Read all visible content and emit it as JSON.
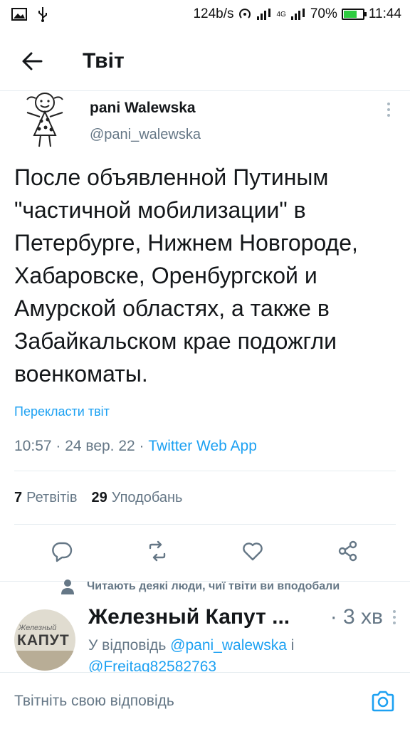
{
  "status": {
    "speed": "124b/s",
    "network": "4G",
    "battery": "70%",
    "battery_level": 0.7,
    "time": "11:44"
  },
  "header": {
    "title": "Твіт"
  },
  "tweet": {
    "author_name": "pani Walewska",
    "author_handle": "@pani_walewska",
    "text": "После объявленной Путиным \"частичной мобилизации\" в Петербурге, Нижнем Новгороде, Хабаровске, Оренбургской и Амурской областях, а также в Забайкальском крае подожгли военкоматы.",
    "translate_label": "Перекласти твіт",
    "timestamp": "10:57 · 24 вер. 22 · ",
    "source": "Twitter Web App",
    "retweets_count": "7",
    "retweets_label": "Ретвітів",
    "likes_count": "29",
    "likes_label": "Уподобань"
  },
  "suggestion": {
    "text": "Читають деякі люди, чиї твіти ви вподобали"
  },
  "reply": {
    "avatar_top": "Железный",
    "avatar_main": "КАПУТ",
    "name": "Железный Капут ...",
    "time": "· 3 хв",
    "reply_prefix": "У відповідь ",
    "mention1": "@pani_walewska",
    "mention_join": " і",
    "mention2": "@Freitag82582763"
  },
  "compose": {
    "placeholder": "Твітніть свою відповідь"
  },
  "colors": {
    "accent": "#1da1f2",
    "text": "#14171a",
    "muted": "#657786"
  }
}
